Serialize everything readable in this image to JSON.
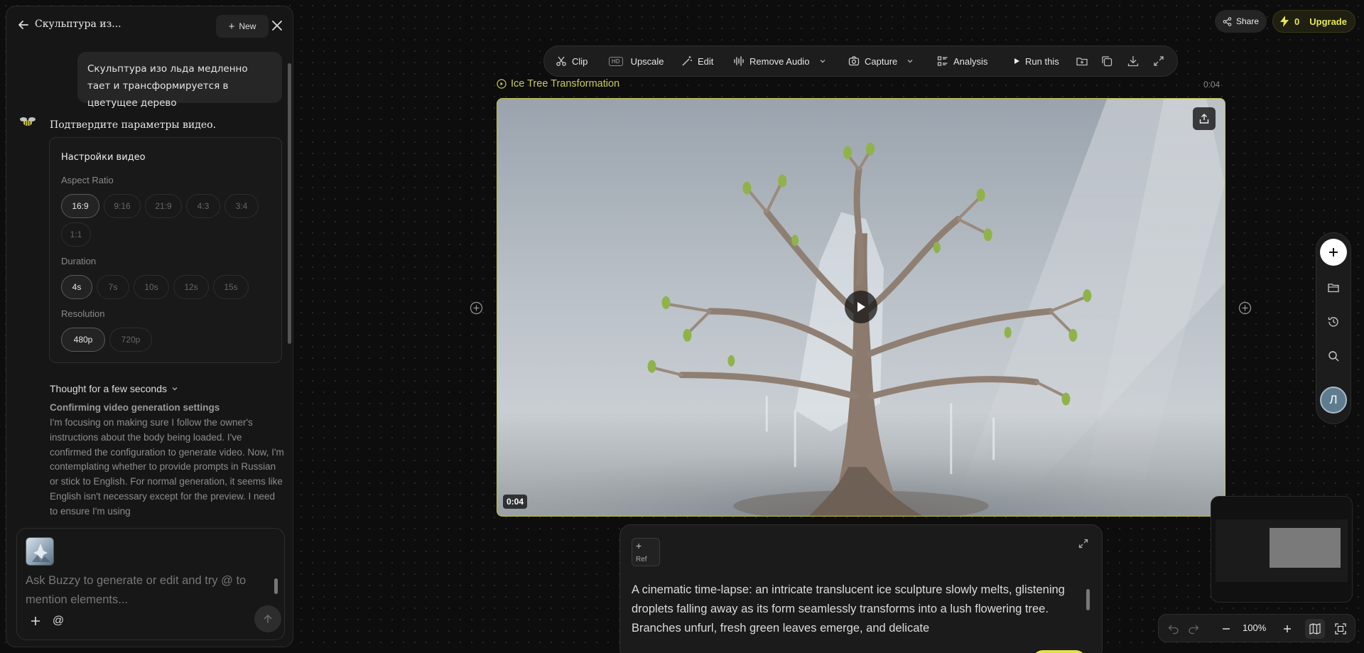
{
  "chat": {
    "title": "Скульптура из...",
    "new_label": "New",
    "user_message": "Скульптура изо льда медленно тает и трансформируется в цветущее дерево",
    "bot_message": "Подтвердите параметры видео.",
    "settings": {
      "title": "Настройки видео",
      "aspect_label": "Aspect Ratio",
      "aspect_options": [
        "16:9",
        "9:16",
        "21:9",
        "4:3",
        "3:4",
        "1:1"
      ],
      "aspect_selected": "16:9",
      "duration_label": "Duration",
      "duration_options": [
        "4s",
        "7s",
        "10s",
        "12s",
        "15s"
      ],
      "duration_selected": "4s",
      "resolution_label": "Resolution",
      "resolution_options": [
        "480p",
        "720p"
      ],
      "resolution_selected": "480p"
    },
    "thought_label": "Thought for a few seconds",
    "thought_heading": "Confirming video generation settings",
    "thought_body": "I'm focusing on making sure I follow the owner's instructions about the body being loaded. I've confirmed the configuration to generate video. Now, I'm contemplating whether to provide prompts in Russian or stick to English. For normal generation, it seems like English isn't necessary except for the preview. I need to ensure I'm using",
    "input_placeholder": "Ask Buzzy to generate or edit and try @ to mention elements...",
    "at_label": "@"
  },
  "topbar": {
    "share_label": "Share",
    "credits": "0",
    "upgrade_label": "Upgrade"
  },
  "toolbar": {
    "clip": "Clip",
    "upscale": "Upscale",
    "hd_badge": "HD",
    "edit": "Edit",
    "remove_audio": "Remove Audio",
    "capture": "Capture",
    "analysis": "Analysis",
    "run_this": "Run this"
  },
  "video": {
    "title": "Ice Tree Transformation",
    "duration": "0:04",
    "current_time": "0:04"
  },
  "prompt": {
    "ref_label": "Ref",
    "text": "A cinematic time-lapse: an intricate translucent ice sculpture slowly melts, glistening droplets falling away as its form seamlessly transforms into a lush flowering tree. Branches unfurl, fresh green leaves emerge, and delicate"
  },
  "rail": {
    "avatar_letter": "Л"
  },
  "zoom": {
    "value": "100%"
  },
  "colors": {
    "accent_yellow": "#c5c54a",
    "upgrade_yellow": "#e6e65a"
  }
}
